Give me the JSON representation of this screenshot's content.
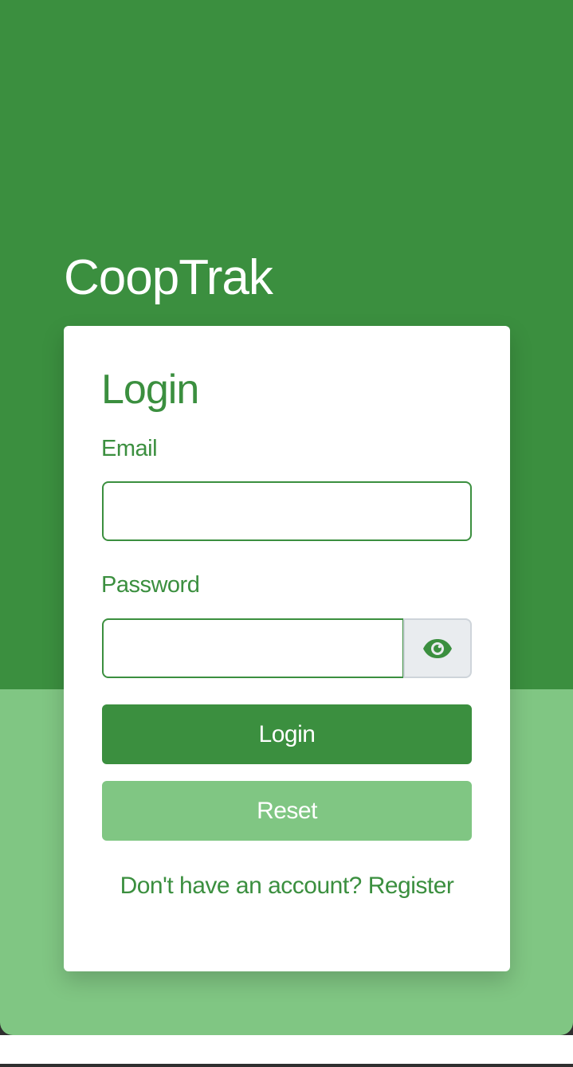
{
  "app": {
    "title": "CoopTrak"
  },
  "login_card": {
    "title": "Login",
    "email": {
      "label": "Email",
      "value": "",
      "placeholder": ""
    },
    "password": {
      "label": "Password",
      "value": "",
      "placeholder": "",
      "toggle_icon": "eye-icon"
    },
    "login_button_label": "Login",
    "reset_button_label": "Reset",
    "register_prompt": "Don't have an account? Register"
  },
  "colors": {
    "primary_green": "#3b8f3f",
    "light_green": "#80c683",
    "toggle_bg": "#e9ecef",
    "card_bg": "#ffffff"
  }
}
